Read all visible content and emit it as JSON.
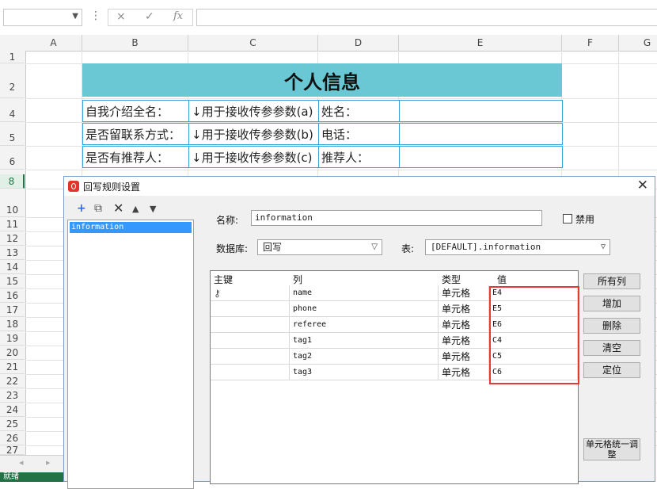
{
  "formula_bar": {
    "cancel_icon": "×",
    "enter_icon": "✓",
    "fx_label": "fx",
    "dots": "⋮"
  },
  "sheet": {
    "columns": [
      "A",
      "B",
      "C",
      "D",
      "E",
      "F",
      "G"
    ],
    "rows": [
      "1",
      "2",
      "4",
      "5",
      "6",
      "8",
      "10",
      "11",
      "12",
      "13",
      "14",
      "15",
      "16",
      "17",
      "18",
      "19",
      "20",
      "21",
      "22",
      "23",
      "24",
      "25",
      "26",
      "27"
    ],
    "title": "个人信息",
    "table": [
      [
        "自我介绍全名：",
        "↓用于接收传参参数(a)",
        "姓名：",
        ""
      ],
      [
        "是否留联系方式：",
        "↓用于接收传参参数(b)",
        "电话：",
        ""
      ],
      [
        "是否有推荐人：",
        "↓用于接收传参参数(c)",
        "推荐人：",
        ""
      ]
    ],
    "status": "就绪"
  },
  "dialog": {
    "title": "回写规则设置",
    "close_icon": "✕",
    "toolbar_icons": [
      "+",
      "⧉",
      "✕",
      "▲",
      "▼"
    ],
    "rule_item": "information",
    "name_label": "名称:",
    "name_value": "information",
    "disable_label": "禁用",
    "db_label": "数据库:",
    "db_value": "回写",
    "table_label": "表:",
    "table_value": "[DEFAULT].information",
    "grid_headers": [
      "主键",
      "列",
      "类型",
      "值"
    ],
    "grid_rows": [
      {
        "key": "⚷",
        "col": "name",
        "type": "单元格",
        "value": "E4"
      },
      {
        "key": "",
        "col": "phone",
        "type": "单元格",
        "value": "E5"
      },
      {
        "key": "",
        "col": "referee",
        "type": "单元格",
        "value": "E6"
      },
      {
        "key": "",
        "col": "tag1",
        "type": "单元格",
        "value": "C4"
      },
      {
        "key": "",
        "col": "tag2",
        "type": "单元格",
        "value": "C5"
      },
      {
        "key": "",
        "col": "tag3",
        "type": "单元格",
        "value": "C6"
      }
    ],
    "buttons": [
      "所有列",
      "增加",
      "删除",
      "清空",
      "定位"
    ],
    "big_button": "单元格统一调整"
  }
}
